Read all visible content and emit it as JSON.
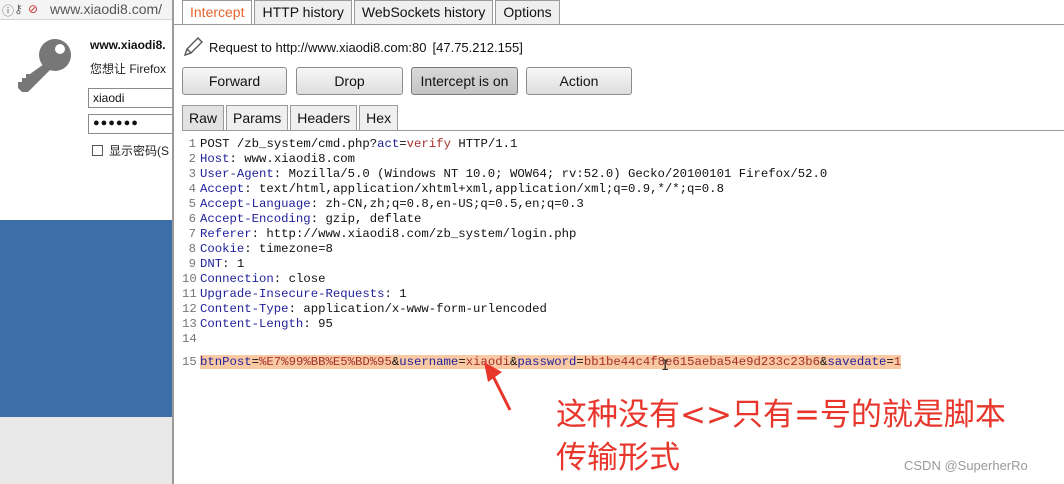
{
  "browser": {
    "url_text": "www.xiaodi8.com/",
    "dialog_site": "www.xiaodi8.",
    "dialog_prompt": "您想让 Firefox",
    "username_value": "xiaodi",
    "password_value": "●●●●●●",
    "show_password_label": "显示密码(S"
  },
  "burp": {
    "top_tabs": [
      {
        "label": "Intercept",
        "active": true
      },
      {
        "label": "HTTP history",
        "active": false
      },
      {
        "label": "WebSockets history",
        "active": false
      },
      {
        "label": "Options",
        "active": false
      }
    ],
    "request_label": "Request to http://www.xiaodi8.com:80",
    "request_ip": "[47.75.212.155]",
    "buttons": {
      "forward": "Forward",
      "drop": "Drop",
      "intercept": "Intercept is on",
      "action": "Action"
    },
    "sub_tabs": [
      {
        "label": "Raw",
        "active": true
      },
      {
        "label": "Params",
        "active": false
      },
      {
        "label": "Headers",
        "active": false
      },
      {
        "label": "Hex",
        "active": false
      }
    ],
    "request_line": {
      "method": "POST",
      "path": "/zb_system/cmd.php?",
      "param": "act",
      "eq": "=",
      "value": "verify",
      "protocol": " HTTP/1.1"
    },
    "headers": [
      {
        "num": "2",
        "name": "Host",
        "value": "www.xiaodi8.com"
      },
      {
        "num": "3",
        "name": "User-Agent",
        "value": "Mozilla/5.0 (Windows NT 10.0; WOW64; rv:52.0) Gecko/20100101 Firefox/52.0"
      },
      {
        "num": "4",
        "name": "Accept",
        "value": "text/html,application/xhtml+xml,application/xml;q=0.9,*/*;q=0.8"
      },
      {
        "num": "5",
        "name": "Accept-Language",
        "value": "zh-CN,zh;q=0.8,en-US;q=0.5,en;q=0.3"
      },
      {
        "num": "6",
        "name": "Accept-Encoding",
        "value": "gzip, deflate"
      },
      {
        "num": "7",
        "name": "Referer",
        "value": "http://www.xiaodi8.com/zb_system/login.php"
      },
      {
        "num": "8",
        "name": "Cookie",
        "value": "timezone=8"
      },
      {
        "num": "9",
        "name": "DNT",
        "value": "1"
      },
      {
        "num": "10",
        "name": "Connection",
        "value": "close"
      },
      {
        "num": "11",
        "name": "Upgrade-Insecure-Requests",
        "value": "1"
      },
      {
        "num": "12",
        "name": "Content-Type",
        "value": "application/x-www-form-urlencoded"
      },
      {
        "num": "13",
        "name": "Content-Length",
        "value": "95"
      }
    ],
    "blank_line_num": "14",
    "body_line_num": "15",
    "body_params": [
      {
        "key": "btnPost",
        "value": "%E7%99%BB%E5%BD%95"
      },
      {
        "key": "username",
        "value": "xiaodi"
      },
      {
        "key": "password",
        "value": "bb1be44c4f8e615aeba54e9d233c23b6"
      },
      {
        "key": "savedate",
        "value": "1"
      }
    ]
  },
  "annotation": {
    "caption_line1": "这种没有<>只有=号的就是脚本",
    "caption_line2": "传输形式",
    "color": "#e8362c"
  },
  "watermark": "CSDN @SuperherRo"
}
